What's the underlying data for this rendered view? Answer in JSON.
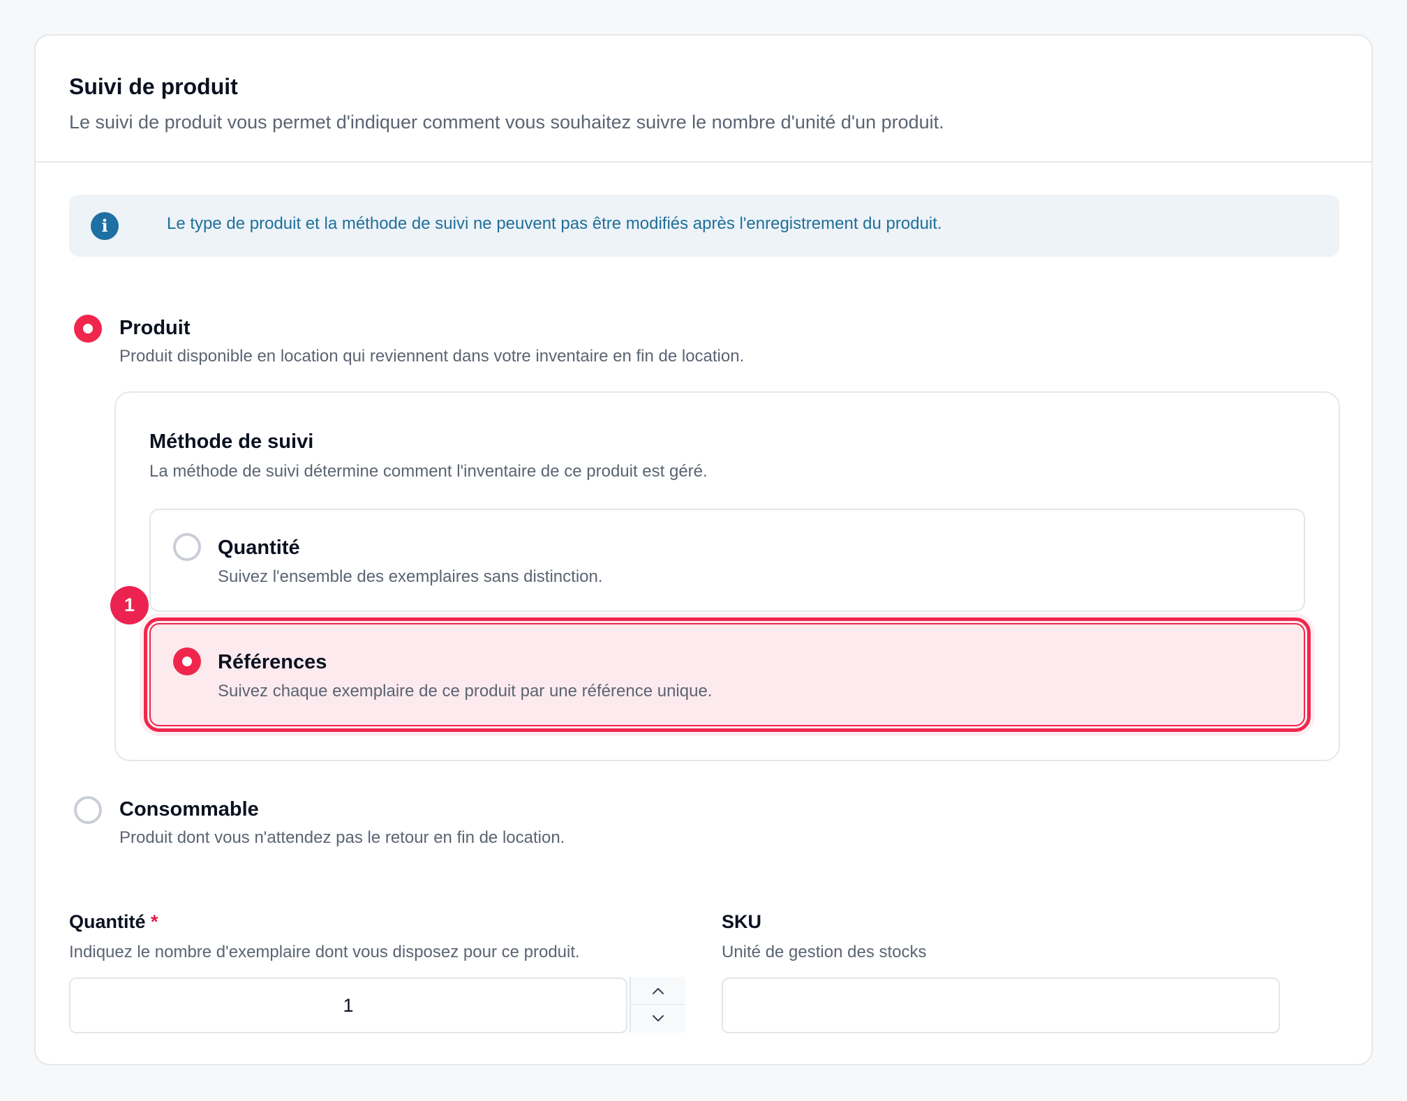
{
  "header": {
    "title": "Suivi de produit",
    "subtitle": "Le suivi de produit vous permet d'indiquer comment vous souhaitez suivre le nombre d'unité d'un produit."
  },
  "info_banner": {
    "icon": "info-icon",
    "icon_glyph": "i",
    "text": "Le type de produit et la méthode de suivi ne peuvent pas être modifiés après l'enregistrement du produit."
  },
  "product_type": {
    "selected": "produit",
    "options": [
      {
        "id": "produit",
        "label": "Produit",
        "description": "Produit disponible en location qui reviennent dans votre inventaire en fin de location.",
        "checked": true
      },
      {
        "id": "consommable",
        "label": "Consommable",
        "description": "Produit dont vous n'attendez pas le retour en fin de location.",
        "checked": false
      }
    ]
  },
  "tracking_method": {
    "title": "Méthode de suivi",
    "subtitle": "La méthode de suivi détermine comment l'inventaire de ce produit est géré.",
    "selected": "references",
    "options": [
      {
        "id": "quantite",
        "label": "Quantité",
        "description": "Suivez l'ensemble des exemplaires sans distinction.",
        "checked": false
      },
      {
        "id": "references",
        "label": "Références",
        "description": "Suivez chaque exemplaire de ce produit par une référence unique.",
        "checked": true
      }
    ]
  },
  "step_badge": "1",
  "quantity_field": {
    "label": "Quantité",
    "required_mark": "*",
    "description": "Indiquez le nombre d'exemplaire dont vous disposez pour ce produit.",
    "value": "1"
  },
  "sku_field": {
    "label": "SKU",
    "description": "Unité de gestion des stocks",
    "value": ""
  },
  "colors": {
    "accent": "#f0264d",
    "info": "#1e6fa3",
    "selected_bg": "#fdeaee"
  }
}
